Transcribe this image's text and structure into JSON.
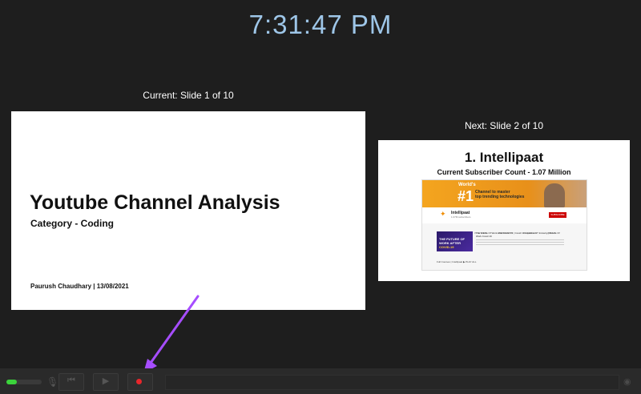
{
  "clock": "7:31:47 PM",
  "current": {
    "caption": "Current: Slide 1 of 10",
    "title": "Youtube Channel Analysis",
    "subtitle": "Category - Coding",
    "author": "Paurush Chaudhary | 13/08/2021"
  },
  "next": {
    "caption": "Next: Slide 2 of 10",
    "title": "1. Intellipaat",
    "subtitle": "Current Subscriber Count - 1.07 Million",
    "youtube": {
      "banner_world": "World's",
      "banner_number": "#1",
      "banner_tagline_1": "Channel to master",
      "banner_tagline_2": "top trending technologies",
      "channel_name": "Intellipaat",
      "subscribers": "1.07M subscribers",
      "subscribe_label": "SUBSCRIBE",
      "tabs": [
        "HOME",
        "VIDEOS",
        "PLAYLISTS",
        "COMMUNITY",
        "CHANNELS",
        "ABOUT"
      ],
      "thumb_text_1": "THE FUTURE OF",
      "thumb_text_2": "WORK AFTER",
      "thumb_text_3": "COVID-19",
      "video_title": "The Future Of Work After Covid 19 | Covid 19 Impact on IT Industry | Future Of Work Covid 19",
      "footer": "Full Courses | Intellipaat ▶ PLAY ALL"
    }
  },
  "toolbar": {
    "mic_icon": "microphone-icon",
    "prev_icon": "previous-icon",
    "play_icon": "play-icon",
    "record_icon": "record-icon",
    "level_fraction": 0.3,
    "colors": {
      "level": "#3bd33b",
      "record": "#e8262b",
      "annotation_arrow": "#a64dff"
    }
  }
}
